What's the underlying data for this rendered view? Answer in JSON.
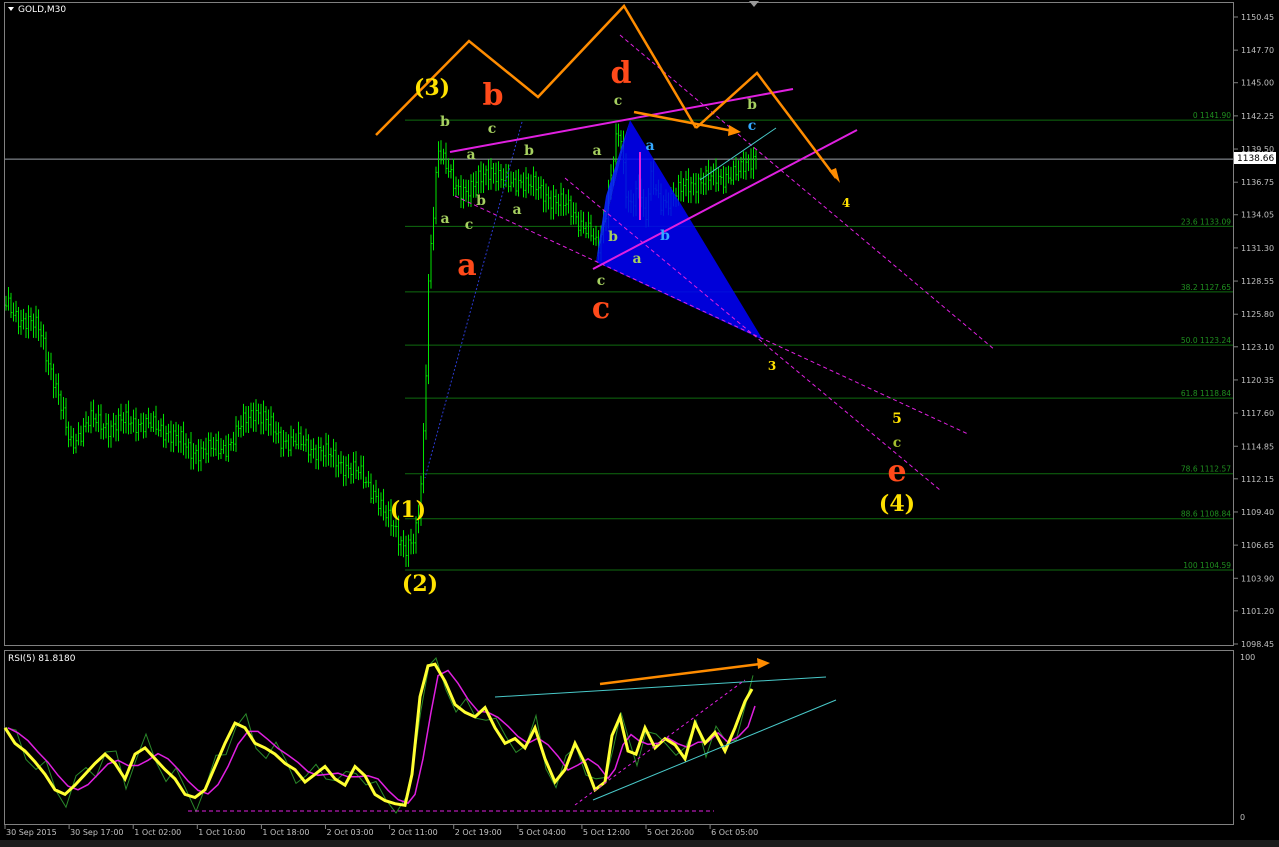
{
  "header": {
    "symbol_label": "GOLD,M30",
    "dropdown_icon": "triangle-down-icon"
  },
  "colors": {
    "background": "#000000",
    "candle": "#00e400",
    "ma": "#3a9a3a",
    "orange": "#ff8c00",
    "magenta": "#e020e0",
    "blue": "#0000ff",
    "fib": "#0f6b0f",
    "rsi_fast": "#ffff33",
    "rsi_slow": "#e020e0",
    "rsi_band": "#2a8a2a",
    "cyan": "#49c9c9",
    "wave_yellow": "#ffe100",
    "wave_red": "#ff4a1a",
    "wave_green": "#a6d060",
    "wave_cyan": "#35a8ff",
    "axis_text": "#c0c0c0"
  },
  "main_axis": {
    "ticks": [
      "1150.45",
      "1147.70",
      "1145.00",
      "1142.25",
      "1139.50",
      "1136.75",
      "1134.05",
      "1131.30",
      "1128.55",
      "1125.80",
      "1123.10",
      "1120.35",
      "1117.60",
      "1114.85",
      "1112.15",
      "1109.40",
      "1106.65",
      "1103.90",
      "1101.20",
      "1098.45"
    ],
    "current_price": "1138.66"
  },
  "fib_levels": [
    {
      "label": "0 1141.90",
      "price": 1141.9
    },
    {
      "label": "23.6 1133.09",
      "price": 1133.09
    },
    {
      "label": "38.2 1127.65",
      "price": 1127.65
    },
    {
      "label": "50.0 1123.24",
      "price": 1123.24
    },
    {
      "label": "61.8 1118.84",
      "price": 1118.84
    },
    {
      "label": "78.6 1112.57",
      "price": 1112.57
    },
    {
      "label": "88.6 1108.84",
      "price": 1108.84
    },
    {
      "label": "100 1104.59",
      "price": 1104.59
    }
  ],
  "rsi": {
    "label": "RSI(5) 81.8180",
    "axis_top": "100",
    "axis_bottom": "0"
  },
  "time_axis": [
    "30 Sep 2015",
    "30 Sep 17:00",
    "1 Oct 02:00",
    "1 Oct 10:00",
    "1 Oct 18:00",
    "2 Oct 03:00",
    "2 Oct 11:00",
    "2 Oct 19:00",
    "5 Oct 04:00",
    "5 Oct 12:00",
    "5 Oct 20:00",
    "6 Oct 05:00"
  ],
  "wave_labels": {
    "primary_3": "(3)",
    "primary_1": "(1)",
    "primary_2": "(2)",
    "primary_4": "(4)",
    "red_a": "a",
    "red_b": "b",
    "red_c": "c",
    "red_d": "d",
    "red_e": "e",
    "y_3": "3",
    "y_4": "4",
    "y_5": "5",
    "y_c": "c",
    "g_b1": "b",
    "g_c1": "c",
    "g_a1": "a",
    "g_b2": "b",
    "g_c2": "c",
    "g_a2": "a",
    "g_b3": "b",
    "g_a3": "a",
    "g_c3": "c",
    "g_b4": "b",
    "g_c4": "c",
    "g_a4": "a",
    "g_b5": "b",
    "b_a": "a",
    "b_b": "b",
    "b_c": "c"
  },
  "chart_data": {
    "type": "candlestick",
    "symbol": "GOLD",
    "timeframe": "M30",
    "y_range": [
      1097.5,
      1151.5
    ],
    "current_price": 1138.66,
    "price_path": [
      [
        0,
        1127
      ],
      [
        20,
        1125.5
      ],
      [
        40,
        1124.5
      ],
      [
        55,
        1120
      ],
      [
        70,
        1115
      ],
      [
        90,
        1117
      ],
      [
        110,
        1116.5
      ],
      [
        130,
        1117
      ],
      [
        150,
        1116.5
      ],
      [
        170,
        1116
      ],
      [
        190,
        1114.5
      ],
      [
        210,
        1114.5
      ],
      [
        230,
        1115
      ],
      [
        245,
        1117
      ],
      [
        255,
        1118
      ],
      [
        265,
        1117
      ],
      [
        280,
        1115.5
      ],
      [
        300,
        1115
      ],
      [
        320,
        1114.5
      ],
      [
        340,
        1113.5
      ],
      [
        360,
        1112.5
      ],
      [
        375,
        1111
      ],
      [
        385,
        1109
      ],
      [
        395,
        1108
      ],
      [
        405,
        1106.5
      ],
      [
        415,
        1107
      ],
      [
        420,
        1110
      ],
      [
        425,
        1118
      ],
      [
        428,
        1128
      ],
      [
        432,
        1133
      ],
      [
        438,
        1139.5
      ],
      [
        445,
        1138
      ],
      [
        455,
        1136.5
      ],
      [
        470,
        1136
      ],
      [
        480,
        1137
      ],
      [
        490,
        1138
      ],
      [
        500,
        1137
      ],
      [
        510,
        1136.5
      ],
      [
        520,
        1137
      ],
      [
        530,
        1136.5
      ],
      [
        540,
        1136
      ],
      [
        550,
        1135.5
      ],
      [
        560,
        1135
      ],
      [
        570,
        1134.5
      ],
      [
        580,
        1133.5
      ],
      [
        590,
        1132.5
      ],
      [
        598,
        1131
      ],
      [
        605,
        1134
      ],
      [
        610,
        1137
      ],
      [
        615,
        1140
      ],
      [
        620,
        1141
      ],
      [
        625,
        1136
      ],
      [
        630,
        1134.5
      ],
      [
        635,
        1136
      ],
      [
        640,
        1137
      ],
      [
        645,
        1133
      ],
      [
        650,
        1137
      ],
      [
        655,
        1136
      ],
      [
        660,
        1135
      ],
      [
        670,
        1135.5
      ],
      [
        680,
        1136
      ],
      [
        690,
        1136.5
      ],
      [
        700,
        1137
      ],
      [
        710,
        1137
      ],
      [
        720,
        1137
      ],
      [
        730,
        1137.5
      ],
      [
        740,
        1137.5
      ],
      [
        750,
        1138.5
      ],
      [
        756,
        1139
      ]
    ],
    "rsi_period": 5,
    "rsi_last": 81.818,
    "rsi_path": [
      [
        5,
        55
      ],
      [
        15,
        45
      ],
      [
        25,
        40
      ],
      [
        35,
        33
      ],
      [
        45,
        25
      ],
      [
        55,
        15
      ],
      [
        65,
        12
      ],
      [
        75,
        18
      ],
      [
        85,
        25
      ],
      [
        95,
        32
      ],
      [
        105,
        38
      ],
      [
        115,
        32
      ],
      [
        125,
        22
      ],
      [
        135,
        38
      ],
      [
        145,
        42
      ],
      [
        155,
        35
      ],
      [
        165,
        28
      ],
      [
        175,
        22
      ],
      [
        185,
        12
      ],
      [
        195,
        10
      ],
      [
        205,
        15
      ],
      [
        215,
        30
      ],
      [
        225,
        45
      ],
      [
        235,
        58
      ],
      [
        245,
        55
      ],
      [
        255,
        45
      ],
      [
        265,
        42
      ],
      [
        275,
        38
      ],
      [
        285,
        32
      ],
      [
        295,
        28
      ],
      [
        305,
        20
      ],
      [
        315,
        25
      ],
      [
        325,
        30
      ],
      [
        335,
        22
      ],
      [
        345,
        18
      ],
      [
        355,
        30
      ],
      [
        365,
        24
      ],
      [
        375,
        12
      ],
      [
        385,
        8
      ],
      [
        395,
        6
      ],
      [
        405,
        5
      ],
      [
        412,
        25
      ],
      [
        420,
        75
      ],
      [
        428,
        95
      ],
      [
        435,
        96
      ],
      [
        445,
        85
      ],
      [
        455,
        70
      ],
      [
        465,
        65
      ],
      [
        475,
        62
      ],
      [
        485,
        68
      ],
      [
        495,
        55
      ],
      [
        505,
        45
      ],
      [
        515,
        48
      ],
      [
        525,
        42
      ],
      [
        535,
        55
      ],
      [
        545,
        35
      ],
      [
        555,
        20
      ],
      [
        565,
        28
      ],
      [
        575,
        45
      ],
      [
        585,
        32
      ],
      [
        595,
        15
      ],
      [
        605,
        20
      ],
      [
        612,
        50
      ],
      [
        620,
        62
      ],
      [
        628,
        40
      ],
      [
        636,
        38
      ],
      [
        645,
        55
      ],
      [
        655,
        42
      ],
      [
        665,
        48
      ],
      [
        675,
        44
      ],
      [
        685,
        35
      ],
      [
        695,
        58
      ],
      [
        705,
        45
      ],
      [
        715,
        52
      ],
      [
        725,
        40
      ],
      [
        735,
        55
      ],
      [
        745,
        72
      ],
      [
        752,
        80
      ]
    ],
    "x_categories": [
      "30 Sep 2015",
      "30 Sep 17:00",
      "1 Oct 02:00",
      "1 Oct 10:00",
      "1 Oct 18:00",
      "2 Oct 03:00",
      "2 Oct 11:00",
      "2 Oct 19:00",
      "5 Oct 04:00",
      "5 Oct 12:00",
      "5 Oct 20:00",
      "6 Oct 05:00"
    ]
  }
}
